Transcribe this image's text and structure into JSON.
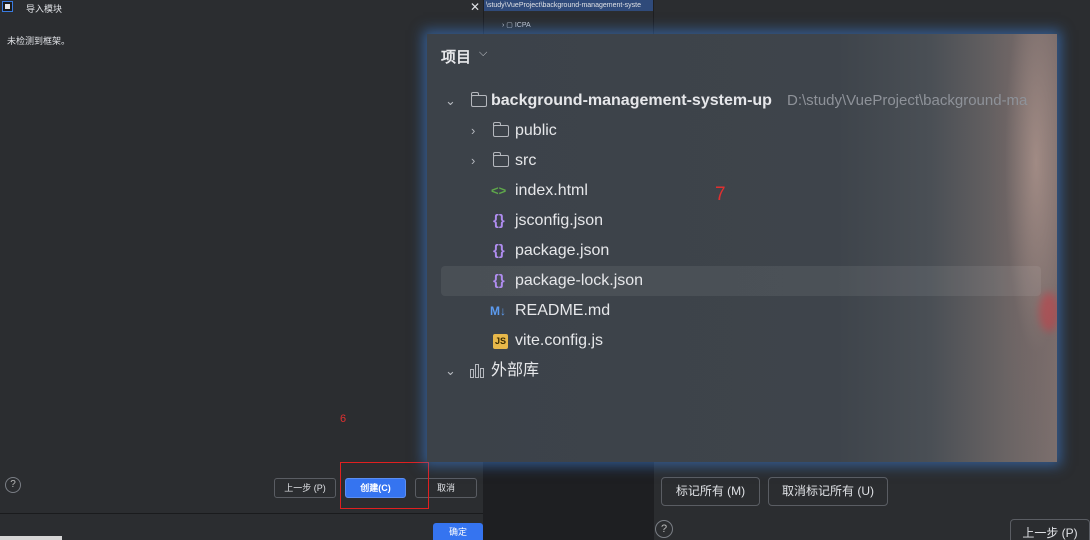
{
  "left_dialog": {
    "title": "导入模块",
    "message": "未检测到框架。",
    "help": "?",
    "prev_button": "上一步 (P)",
    "create_button": "创建(C)",
    "cancel_button": "取消",
    "ok_button": "确定",
    "annotation": "6",
    "close_glyph": "✕"
  },
  "background_tree": {
    "path_text": "\\study\\VueProject\\background-management-syste",
    "folder_label": "ICPA"
  },
  "project_popup": {
    "header": "项目",
    "annotation": "7",
    "root": {
      "name": "background-management-system-up",
      "path": "D:\\study\\VueProject\\background-ma"
    },
    "items": [
      {
        "label": "public",
        "icon": "folder-icon"
      },
      {
        "label": "src",
        "icon": "folder-icon"
      },
      {
        "label": "index.html",
        "icon": "html-file-icon"
      },
      {
        "label": "jsconfig.json",
        "icon": "json-file-icon"
      },
      {
        "label": "package.json",
        "icon": "json-file-icon"
      },
      {
        "label": "package-lock.json",
        "icon": "json-file-icon"
      },
      {
        "label": "README.md",
        "icon": "markdown-file-icon"
      },
      {
        "label": "vite.config.js",
        "icon": "js-file-icon"
      }
    ],
    "external_libraries": "外部库"
  },
  "right_dialog": {
    "mark_all_button": "标记所有 (M)",
    "unmark_all_button": "取消标记所有 (U)",
    "prev_button": "上一步 (P)",
    "help": "?"
  },
  "colors": {
    "accent_blue": "#3574f0",
    "annotation_red": "#e02020",
    "json_icon": "#b08df0",
    "html_icon": "#5fa84b",
    "js_icon": "#e8b84a"
  }
}
